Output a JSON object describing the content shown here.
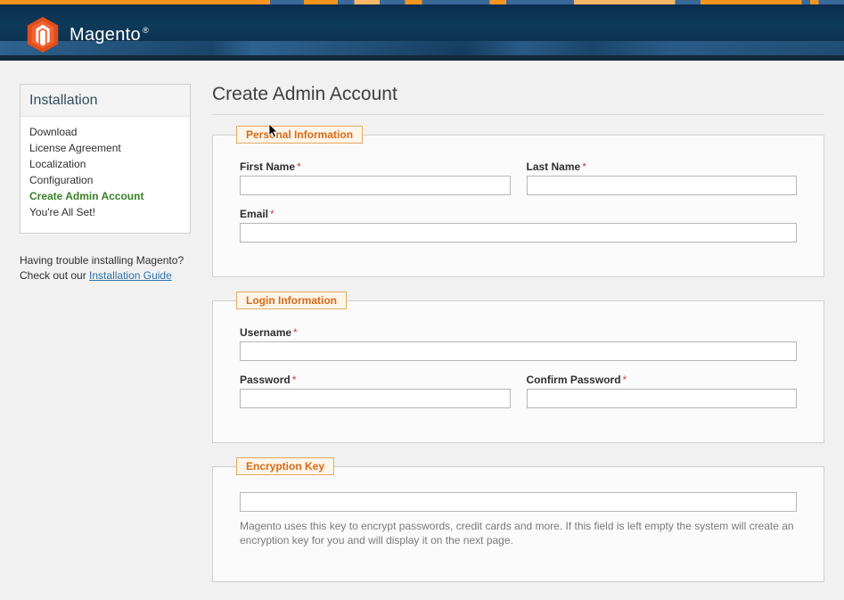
{
  "brand": {
    "name": "Magento",
    "registered": "®"
  },
  "sidebar": {
    "title": "Installation",
    "items": [
      "Download",
      "License Agreement",
      "Localization",
      "Configuration",
      "Create Admin Account",
      "You're All Set!"
    ],
    "active_index": 4,
    "help_line1": "Having trouble installing Magento?",
    "help_line2_prefix": "Check out our ",
    "help_link": "Installation Guide"
  },
  "page_title": "Create Admin Account",
  "sections": {
    "personal": {
      "legend": "Personal Information",
      "first_name_label": "First Name",
      "last_name_label": "Last Name",
      "email_label": "Email"
    },
    "login": {
      "legend": "Login Information",
      "username_label": "Username",
      "password_label": "Password",
      "confirm_password_label": "Confirm Password"
    },
    "encryption": {
      "legend": "Encryption Key",
      "hint": "Magento uses this key to encrypt passwords, credit cards and more. If this field is left empty the system will create an encryption key for you and will display it on the next page."
    }
  },
  "required_marker": "*"
}
